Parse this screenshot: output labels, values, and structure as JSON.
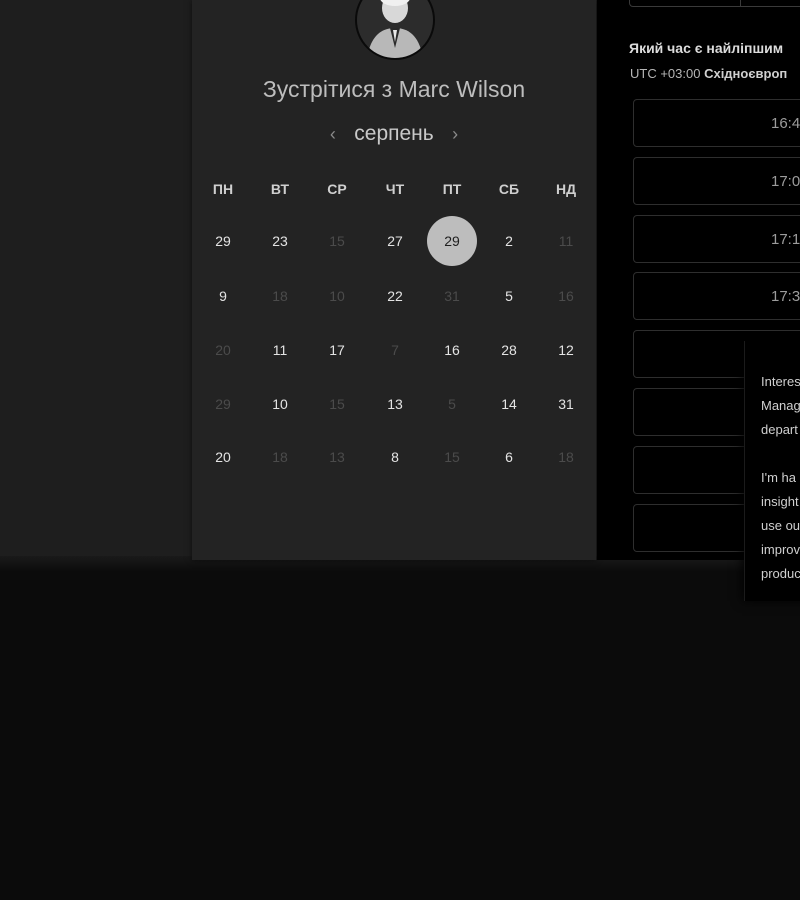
{
  "meeting": {
    "title": "Зустрітися з Marc Wilson",
    "month": "серпень",
    "prev_label": "‹",
    "next_label": "›",
    "weekdays": [
      "ПН",
      "ВТ",
      "СР",
      "ЧТ",
      "ПТ",
      "СБ",
      "НД"
    ],
    "weeks": [
      [
        {
          "d": "29",
          "on": true
        },
        {
          "d": "23",
          "on": true
        },
        {
          "d": "15",
          "on": false
        },
        {
          "d": "27",
          "on": true
        },
        {
          "d": "29",
          "on": true,
          "selected": true
        },
        {
          "d": "2",
          "on": true
        },
        {
          "d": "11",
          "on": false
        }
      ],
      [
        {
          "d": "9",
          "on": true
        },
        {
          "d": "18",
          "on": false
        },
        {
          "d": "10",
          "on": false
        },
        {
          "d": "22",
          "on": true
        },
        {
          "d": "31",
          "on": false
        },
        {
          "d": "5",
          "on": true
        },
        {
          "d": "16",
          "on": false
        }
      ],
      [
        {
          "d": "20",
          "on": false
        },
        {
          "d": "11",
          "on": true
        },
        {
          "d": "17",
          "on": true
        },
        {
          "d": "7",
          "on": false
        },
        {
          "d": "16",
          "on": true
        },
        {
          "d": "28",
          "on": true
        },
        {
          "d": "12",
          "on": true
        }
      ],
      [
        {
          "d": "29",
          "on": false
        },
        {
          "d": "10",
          "on": true
        },
        {
          "d": "15",
          "on": false
        },
        {
          "d": "13",
          "on": true
        },
        {
          "d": "5",
          "on": false
        },
        {
          "d": "14",
          "on": true
        },
        {
          "d": "31",
          "on": true
        }
      ],
      [
        {
          "d": "20",
          "on": true
        },
        {
          "d": "18",
          "on": false
        },
        {
          "d": "13",
          "on": false
        },
        {
          "d": "8",
          "on": true
        },
        {
          "d": "15",
          "on": false
        },
        {
          "d": "6",
          "on": true
        },
        {
          "d": "18",
          "on": false
        }
      ]
    ]
  },
  "times": {
    "question": "Який час є найліпшим",
    "tz_prefix": "UTC +03:00",
    "tz_name": "Східноєвроп",
    "slots": [
      "16:4",
      "17:0",
      "17:1",
      "17:3",
      "",
      "",
      "",
      ""
    ]
  },
  "popup": {
    "lines": [
      "Interes",
      "Manag",
      "depart",
      "",
      "I'm ha",
      "insight",
      "use ou",
      "improv",
      "produc"
    ]
  }
}
